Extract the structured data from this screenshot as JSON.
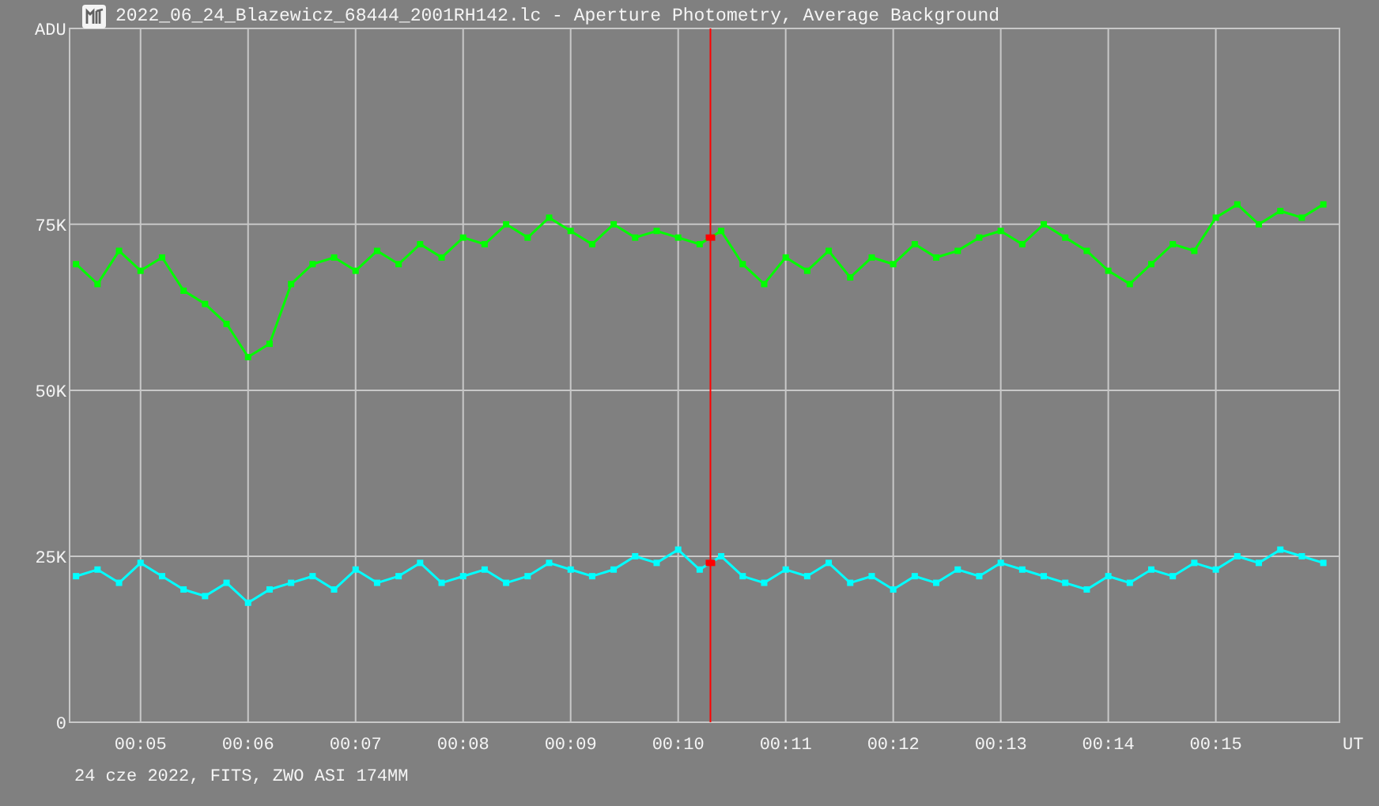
{
  "window": {
    "title": "2022_06_24_Blazewicz_68444_2001RH142.lc - Aperture Photometry, Average Background"
  },
  "chart": {
    "chart_data": {
      "type": "line",
      "xlabel": "UT",
      "ylabel": "ADU",
      "x": [
        4.4,
        4.6,
        4.8,
        5.0,
        5.2,
        5.4,
        5.6,
        5.8,
        6.0,
        6.2,
        6.4,
        6.6,
        6.8,
        7.0,
        7.2,
        7.4,
        7.6,
        7.8,
        8.0,
        8.2,
        8.4,
        8.6,
        8.8,
        9.0,
        9.2,
        9.4,
        9.6,
        9.8,
        10.0,
        10.2,
        10.4,
        10.6,
        10.8,
        11.0,
        11.2,
        11.4,
        11.6,
        11.8,
        12.0,
        12.2,
        12.4,
        12.6,
        12.8,
        13.0,
        13.2,
        13.4,
        13.6,
        13.8,
        14.0,
        14.2,
        14.4,
        14.6,
        14.8,
        15.0,
        15.2,
        15.4,
        15.6,
        15.8,
        16.0
      ],
      "series": [
        {
          "color": "#00ff00",
          "marker": "square",
          "values": [
            69000,
            66000,
            71000,
            68000,
            70000,
            65000,
            63000,
            60000,
            55000,
            57000,
            66000,
            69000,
            70000,
            68000,
            71000,
            69000,
            72000,
            70000,
            73000,
            72000,
            75000,
            73000,
            76000,
            74000,
            72000,
            75000,
            73000,
            74000,
            73000,
            72000,
            74000,
            69000,
            66000,
            70000,
            68000,
            71000,
            67000,
            70000,
            69000,
            72000,
            70000,
            71000,
            73000,
            74000,
            72000,
            75000,
            73000,
            71000,
            68000,
            66000,
            69000,
            72000,
            71000,
            76000,
            78000,
            75000,
            77000,
            76000,
            78000
          ]
        },
        {
          "color": "#00ffff",
          "marker": "square",
          "values": [
            22000,
            23000,
            21000,
            24000,
            22000,
            20000,
            19000,
            21000,
            18000,
            20000,
            21000,
            22000,
            20000,
            23000,
            21000,
            22000,
            24000,
            21000,
            22000,
            23000,
            21000,
            22000,
            24000,
            23000,
            22000,
            23000,
            25000,
            24000,
            26000,
            23000,
            25000,
            22000,
            21000,
            23000,
            22000,
            24000,
            21000,
            22000,
            20000,
            22000,
            21000,
            23000,
            22000,
            24000,
            23000,
            22000,
            21000,
            20000,
            22000,
            21000,
            23000,
            22000,
            24000,
            23000,
            25000,
            24000,
            26000,
            25000,
            24000
          ]
        }
      ],
      "xlim": [
        4.34,
        16.15
      ],
      "ylim": [
        0,
        104500
      ],
      "xticks": [
        {
          "value": 5,
          "label": "00:05"
        },
        {
          "value": 6,
          "label": "00:06"
        },
        {
          "value": 7,
          "label": "00:07"
        },
        {
          "value": 8,
          "label": "00:08"
        },
        {
          "value": 9,
          "label": "00:09"
        },
        {
          "value": 10,
          "label": "00:10"
        },
        {
          "value": 11,
          "label": "00:11"
        },
        {
          "value": 12,
          "label": "00:12"
        },
        {
          "value": 13,
          "label": "00:13"
        },
        {
          "value": 14,
          "label": "00:14"
        },
        {
          "value": 15,
          "label": "00:15"
        }
      ],
      "yticks": [
        {
          "value": 0,
          "label": "0"
        },
        {
          "value": 25000,
          "label": "25K"
        },
        {
          "value": 50000,
          "label": "50K"
        },
        {
          "value": 75000,
          "label": "75K"
        }
      ],
      "grid": true,
      "ref_lines": [
        {
          "axis": "x",
          "value": 10.3,
          "color": "#ff0000"
        }
      ]
    }
  },
  "status": {
    "text": "24 cze 2022, FITS, ZWO ASI 174MM"
  }
}
